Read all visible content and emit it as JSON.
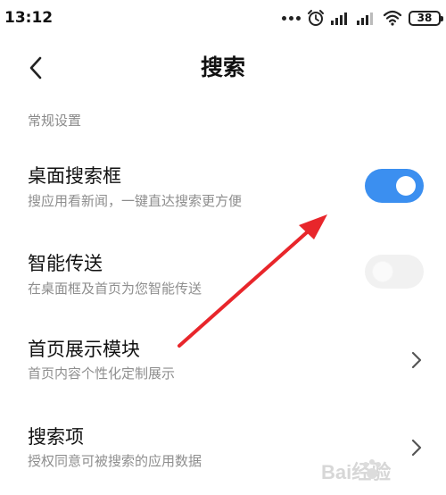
{
  "status_bar": {
    "time": "13:12",
    "battery": "38"
  },
  "header": {
    "title": "搜索"
  },
  "section": {
    "title": "常规设置"
  },
  "settings": [
    {
      "title": "桌面搜索框",
      "description": "搜应用看新闻，一键直达搜索更方便",
      "control": "toggle",
      "enabled": true
    },
    {
      "title": "智能传送",
      "description": "在桌面框及首页为您智能传送",
      "control": "toggle",
      "enabled": false
    },
    {
      "title": "首页展示模块",
      "description": "首页内容个性化定制展示",
      "control": "chevron"
    },
    {
      "title": "搜索项",
      "description": "授权同意可被搜索的应用数据",
      "control": "chevron"
    }
  ],
  "colors": {
    "accent": "#3b8ff0",
    "annotation_arrow": "#e8262b"
  },
  "watermark": {
    "text": "Bai经验"
  }
}
